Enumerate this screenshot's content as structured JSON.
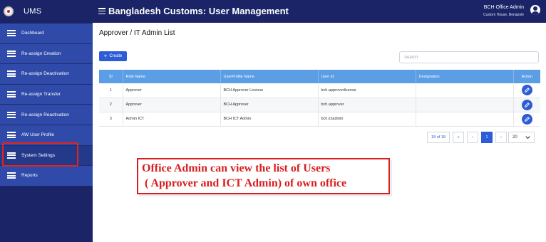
{
  "app": {
    "brand": "UMS",
    "title": "Bangladesh Customs: User Management"
  },
  "user": {
    "name": "BCH Office Admin",
    "office": "Custom House, Benapole"
  },
  "sidebar": {
    "items": [
      {
        "label": "Dashboard"
      },
      {
        "label": "Re-assign Creation"
      },
      {
        "label": "Re-assign Deactivation"
      },
      {
        "label": "Re-assign Transfer"
      },
      {
        "label": "Re-assign Reactivation"
      },
      {
        "label": "AW User Profile"
      },
      {
        "label": "System Settings"
      },
      {
        "label": "Reports"
      }
    ]
  },
  "page": {
    "title": "Approver / IT Admin List",
    "create_label": "Create",
    "search_placeholder": "Search"
  },
  "table": {
    "headers": [
      "Sl",
      "Role Name",
      "UserProfile Name",
      "User Id",
      "Designation",
      "Action"
    ],
    "rows": [
      {
        "sl": "1",
        "role": "Approver",
        "profile": "BCH Approver License",
        "user_id": "bch.approverlicense",
        "designation": ""
      },
      {
        "sl": "2",
        "role": "Approver",
        "profile": "BCH Approver",
        "user_id": "bch.approver",
        "designation": ""
      },
      {
        "sl": "3",
        "role": "Admin ICT",
        "profile": "BCH ICT Admin",
        "user_id": "bch.ictadmin",
        "designation": ""
      }
    ]
  },
  "pagination": {
    "info": "18 of 18",
    "first": "«",
    "prev": "‹",
    "current": "1",
    "next": "›",
    "last": "»",
    "page_size": "20"
  },
  "annotation": {
    "line1": "Office Admin can view the list of Users",
    "line2": " ( Approver and ICT Admin) of own office"
  },
  "colors": {
    "sidebar": "#1a2466",
    "menu_item": "#2f4aa8",
    "primary": "#2e5bd6",
    "table_header": "#5b9ee6",
    "annotation": "#d81e1e"
  }
}
